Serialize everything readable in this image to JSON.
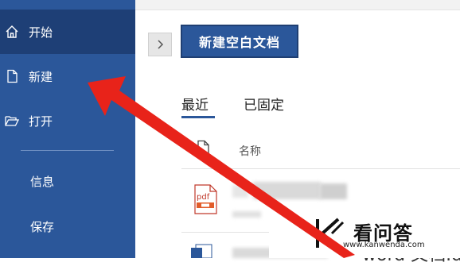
{
  "sidebar": {
    "items": [
      {
        "label": "开始",
        "icon": "home-icon"
      },
      {
        "label": "新建",
        "icon": "new-document-icon"
      },
      {
        "label": "打开",
        "icon": "open-folder-icon"
      },
      {
        "label": "信息"
      },
      {
        "label": "保存"
      }
    ]
  },
  "main": {
    "new_blank_button": "新建空白文档",
    "tabs": [
      "最近",
      "已固定"
    ],
    "column_name": "名称",
    "file_type_badge": "pdf",
    "partial_filename": "word 文档.do"
  },
  "watermark": {
    "text": "看问答",
    "url": "www.kanwenda.com"
  },
  "colors": {
    "sidebar": "#2b579a",
    "sidebar_active": "#1e3f76",
    "arrow": "#e8231a"
  }
}
